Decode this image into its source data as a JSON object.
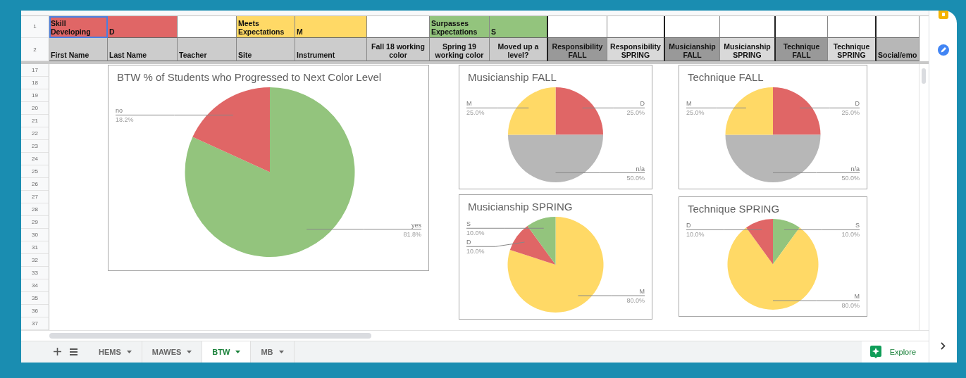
{
  "header_row_1": {
    "row_number": "1",
    "cells": [
      {
        "text": "Skill Developing",
        "color": "#e06666",
        "selected": true
      },
      {
        "text": "D",
        "color": "#e06666",
        "selected": false
      },
      {
        "color": "#ffffff",
        "selected": false
      },
      {
        "text": "Meets Expectations",
        "color": "#ffd966",
        "selected": false
      },
      {
        "text": "M",
        "color": "#ffd966",
        "selected": false
      },
      {
        "color": "#ffffff",
        "selected": false
      },
      {
        "text": "Surpasses Expectations",
        "color": "#93c47d",
        "selected": false
      },
      {
        "text": "S",
        "color": "#93c47d",
        "selected": false
      },
      {
        "color": "#ffffff",
        "selected": false
      },
      {
        "color": "#ffffff",
        "selected": false
      },
      {
        "color": "#ffffff",
        "selected": false
      },
      {
        "color": "#ffffff",
        "selected": false
      },
      {
        "color": "#ffffff",
        "selected": false
      },
      {
        "color": "#ffffff",
        "selected": false
      },
      {
        "color": "#ffffff",
        "selected": false
      }
    ]
  },
  "header_row_2": {
    "row_number": "2",
    "cells": [
      {
        "text": "First Name",
        "color": "#cccccc"
      },
      {
        "text": "Last Name",
        "color": "#cccccc"
      },
      {
        "text": "Teacher",
        "color": "#cccccc"
      },
      {
        "text": "Site",
        "color": "#cccccc"
      },
      {
        "text": "Instrument",
        "color": "#cccccc"
      },
      {
        "text": "Fall 18 working color",
        "color": "#cccccc"
      },
      {
        "text": "Spring 19 working color",
        "color": "#cccccc"
      },
      {
        "text": "Moved up a level?",
        "color": "#cccccc"
      },
      {
        "text": "Responsibility FALL",
        "color": "#999999"
      },
      {
        "text": "Responsibility SPRING",
        "color": "#d9d9d9"
      },
      {
        "text": "Musicianship FALL",
        "color": "#999999"
      },
      {
        "text": "Musicianship SPRING",
        "color": "#d9d9d9"
      },
      {
        "text": "Technique FALL",
        "color": "#999999"
      },
      {
        "text": "Technique SPRING",
        "color": "#d9d9d9"
      },
      {
        "text": "Social/emo",
        "color": "#b7b7b7"
      }
    ]
  },
  "row_numbers": [
    "17",
    "18",
    "19",
    "20",
    "21",
    "22",
    "23",
    "24",
    "25",
    "26",
    "27",
    "28",
    "29",
    "30",
    "31",
    "32",
    "33",
    "34",
    "35",
    "36",
    "37"
  ],
  "charts": [
    {
      "chart_data": {
        "type": "pie",
        "title": "BTW % of Students who Progressed to Next Color Level",
        "categories": [
          "yes",
          "no"
        ],
        "values": [
          81.8,
          18.2
        ],
        "colors": [
          "#93c47d",
          "#e06666"
        ],
        "value_labels": [
          "81.8%",
          "18.2%"
        ]
      }
    },
    {
      "chart_data": {
        "type": "pie",
        "title": "Musicianship FALL",
        "categories": [
          "D",
          "n/a",
          "M"
        ],
        "values": [
          25,
          50,
          25
        ],
        "colors": [
          "#e06666",
          "#b7b7b7",
          "#ffd966"
        ],
        "value_labels": [
          "25.0%",
          "50.0%",
          "25.0%"
        ]
      }
    },
    {
      "chart_data": {
        "type": "pie",
        "title": "Technique FALL",
        "categories": [
          "D",
          "n/a",
          "M"
        ],
        "values": [
          25,
          50,
          25
        ],
        "colors": [
          "#e06666",
          "#b7b7b7",
          "#ffd966"
        ],
        "value_labels": [
          "25.0%",
          "50.0%",
          "25.0%"
        ]
      }
    },
    {
      "chart_data": {
        "type": "pie",
        "title": "Musicianship SPRING",
        "categories": [
          "M",
          "D",
          "S"
        ],
        "values": [
          80,
          10,
          10
        ],
        "colors": [
          "#ffd966",
          "#e06666",
          "#93c47d"
        ],
        "value_labels": [
          "80.0%",
          "10.0%",
          "10.0%"
        ]
      }
    },
    {
      "chart_data": {
        "type": "pie",
        "title": "Technique SPRING",
        "categories": [
          "S",
          "M",
          "D"
        ],
        "values": [
          10,
          80,
          10
        ],
        "colors": [
          "#93c47d",
          "#ffd966",
          "#e06666"
        ],
        "value_labels": [
          "10.0%",
          "80.0%",
          "10.0%"
        ]
      }
    }
  ],
  "sheet_tabs": [
    {
      "label": "HEMS",
      "selected": false
    },
    {
      "label": "MAWES",
      "selected": false
    },
    {
      "label": "BTW",
      "selected": true
    },
    {
      "label": "MB",
      "selected": false
    }
  ],
  "explore_button": {
    "label": "Explore"
  }
}
